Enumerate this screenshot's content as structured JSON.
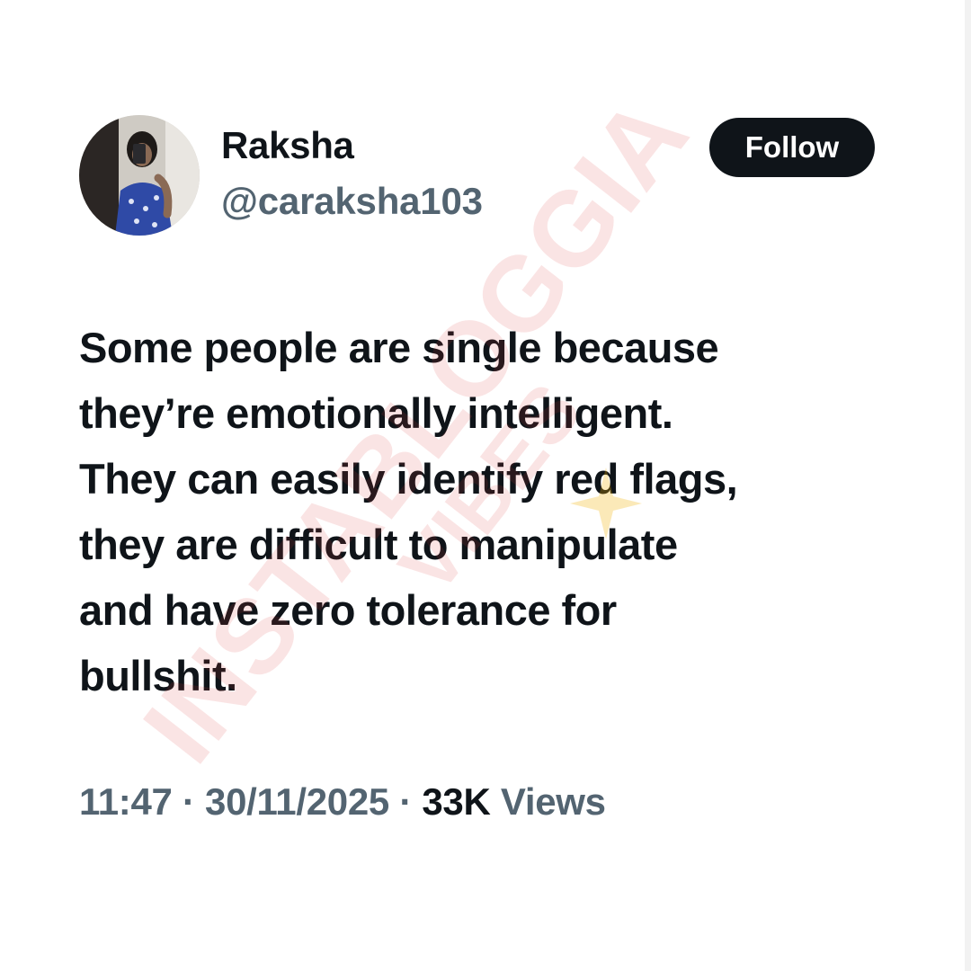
{
  "tweet": {
    "author": {
      "display_name": "Raksha",
      "handle": "@caraksha103"
    },
    "follow_label": "Follow",
    "text": "Some people are single because\nthey’re emotionally intelligent.\nThey can easily identify red flags,\nthey are difficult to manipulate\nand have zero tolerance for\nbullshit.",
    "time": "11:47",
    "separator": "·",
    "date": "30/11/2025",
    "views_count": "33K",
    "views_label": "Views"
  },
  "watermark": {
    "line1": "INSTABLOGGIA",
    "line2": "VIBES"
  },
  "colors": {
    "text_primary": "#0f1419",
    "text_secondary": "#536471",
    "button_bg": "#0f1419",
    "watermark": "#e03a3a"
  }
}
